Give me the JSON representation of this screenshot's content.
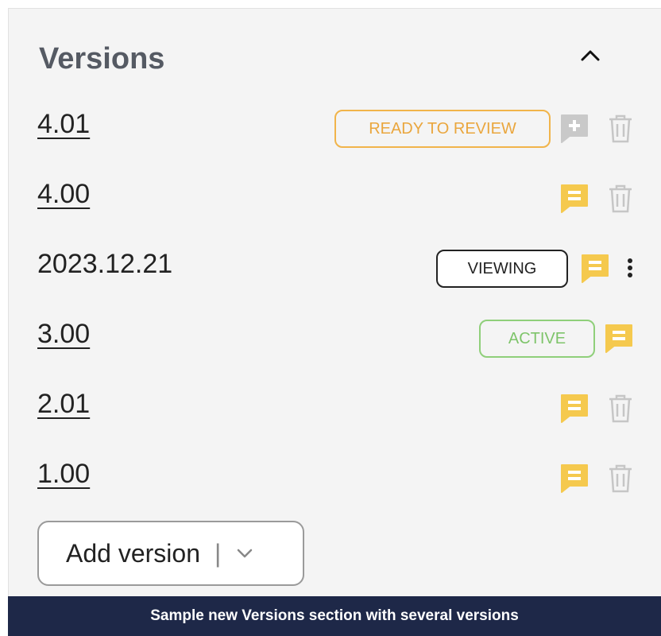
{
  "section": {
    "title": "Versions"
  },
  "versions": [
    {
      "label": "4.01",
      "badge": "READY TO REVIEW",
      "comment_state": "add"
    },
    {
      "label": "4.00",
      "comment_state": "has-comments"
    },
    {
      "label": "2023.12.21",
      "badge": "VIEWING",
      "comment_state": "has-comments"
    },
    {
      "label": "3.00",
      "badge": "ACTIVE",
      "comment_state": "has-comments"
    },
    {
      "label": "2.01",
      "comment_state": "has-comments"
    },
    {
      "label": "1.00",
      "comment_state": "has-comments"
    }
  ],
  "add_button": {
    "label": "Add version",
    "separator": "|"
  },
  "footer": {
    "caption": "Sample new Versions section with several versions"
  },
  "colors": {
    "comment": "#f5c94e",
    "comment_disabled": "#c9c9c9",
    "trash": "#c6c6c6",
    "review": "#f1b44a",
    "active": "#8fcf7a",
    "footer_bg": "#1e2848"
  }
}
